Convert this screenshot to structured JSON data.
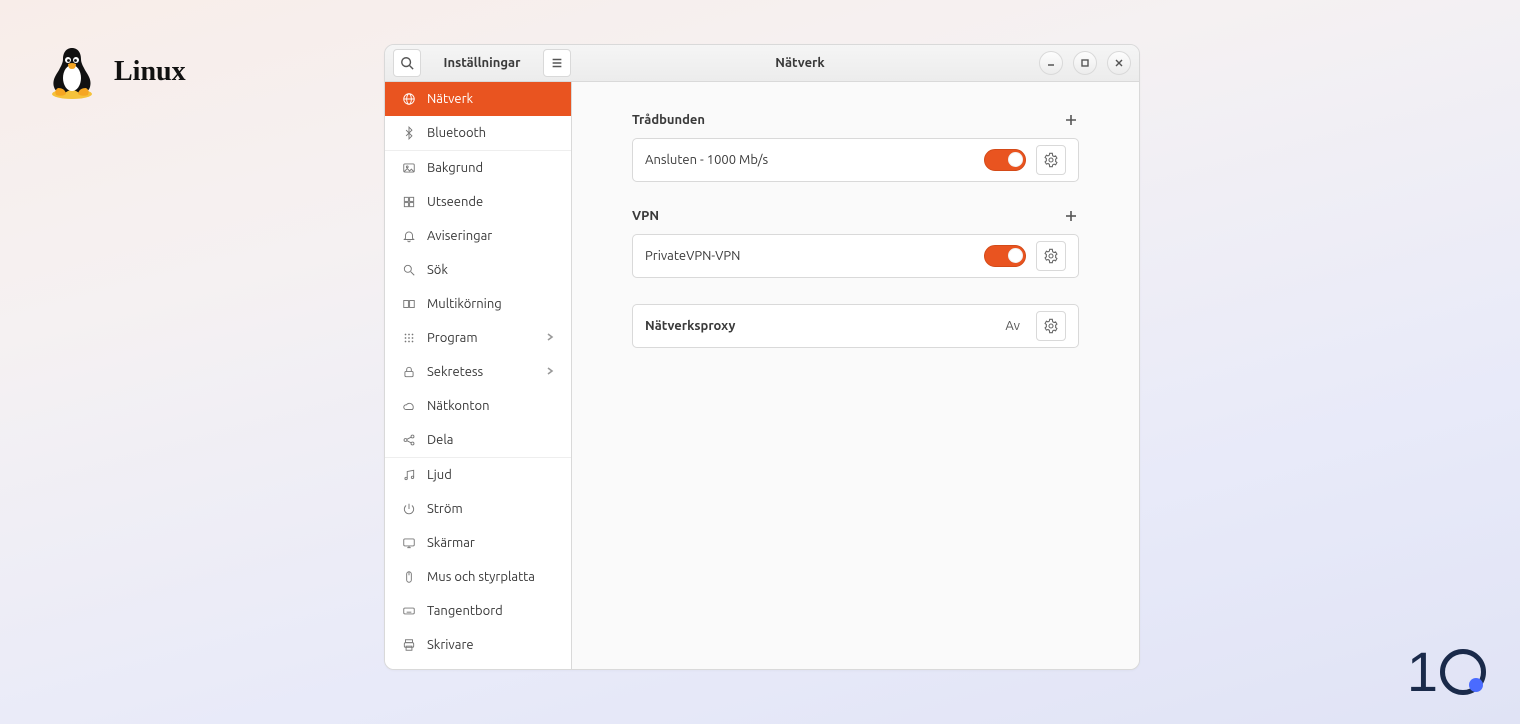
{
  "os_label": "Linux",
  "window": {
    "settings_label": "Inställningar",
    "page_title": "Nätverk"
  },
  "sidebar": {
    "items": [
      {
        "key": "network",
        "label": "Nätverk",
        "icon": "globe",
        "active": true
      },
      {
        "key": "bluetooth",
        "label": "Bluetooth",
        "icon": "bluetooth"
      },
      {
        "key": "background",
        "label": "Bakgrund",
        "icon": "wallpaper",
        "sep_before": true
      },
      {
        "key": "appearance",
        "label": "Utseende",
        "icon": "appearance"
      },
      {
        "key": "notifications",
        "label": "Aviseringar",
        "icon": "bell"
      },
      {
        "key": "search",
        "label": "Sök",
        "icon": "search"
      },
      {
        "key": "multitask",
        "label": "Multikörning",
        "icon": "multitask"
      },
      {
        "key": "applications",
        "label": "Program",
        "icon": "grid",
        "chevron": true
      },
      {
        "key": "privacy",
        "label": "Sekretess",
        "icon": "lock",
        "chevron": true
      },
      {
        "key": "online_accounts",
        "label": "Nätkonton",
        "icon": "cloud"
      },
      {
        "key": "sharing",
        "label": "Dela",
        "icon": "share"
      },
      {
        "key": "sound",
        "label": "Ljud",
        "icon": "music",
        "sep_before": true
      },
      {
        "key": "power",
        "label": "Ström",
        "icon": "power"
      },
      {
        "key": "displays",
        "label": "Skärmar",
        "icon": "display"
      },
      {
        "key": "mouse",
        "label": "Mus och styrplatta",
        "icon": "mouse"
      },
      {
        "key": "keyboard",
        "label": "Tangentbord",
        "icon": "keyboard"
      },
      {
        "key": "printers",
        "label": "Skrivare",
        "icon": "printer"
      }
    ]
  },
  "content": {
    "wired": {
      "title": "Trådbunden",
      "status": "Ansluten - 1000 Mb/s",
      "on": true
    },
    "vpn": {
      "title": "VPN",
      "name": "PrivateVPN-VPN",
      "on": true
    },
    "proxy": {
      "title": "Nätverksproxy",
      "value": "Av"
    }
  }
}
